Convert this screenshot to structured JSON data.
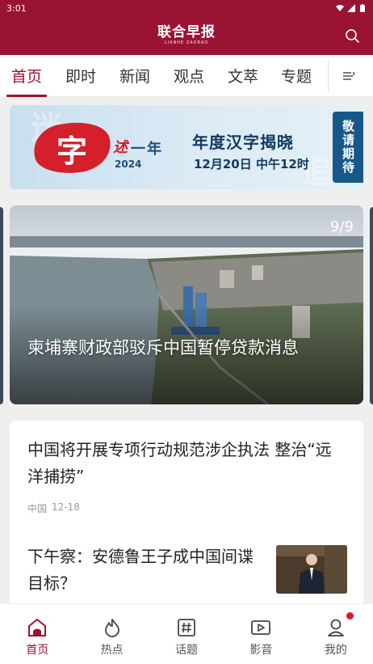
{
  "status": {
    "time": "3:01"
  },
  "header": {
    "logo_text": "联合早报",
    "logo_sub": "LIANHE ZAOBAO"
  },
  "tabs": [
    {
      "label": "首页"
    },
    {
      "label": "即时"
    },
    {
      "label": "新闻"
    },
    {
      "label": "观点"
    },
    {
      "label": "文萃"
    },
    {
      "label": "专题"
    }
  ],
  "banner": {
    "char": "字",
    "shu": "述",
    "yinian": "一年",
    "year": "2024",
    "title": "年度汉字揭晓",
    "date": "12月20日 中午12时",
    "cta": "敬请期待"
  },
  "hero": {
    "counter": "9/9",
    "caption": "柬埔寨财政部驳斥中国暂停贷款消息"
  },
  "articles": [
    {
      "title": "中国将开展专项行动规范涉企执法 整治“远洋捕捞”",
      "section": "中国",
      "date": "12-18"
    },
    {
      "title": "下午察：安德鲁王子成中国间谍目标？"
    }
  ],
  "bottom_nav": [
    {
      "label": "首页",
      "icon": "home-icon"
    },
    {
      "label": "热点",
      "icon": "flame-icon"
    },
    {
      "label": "话题",
      "icon": "hashtag-icon"
    },
    {
      "label": "影音",
      "icon": "video-icon"
    },
    {
      "label": "我的",
      "icon": "profile-icon"
    }
  ],
  "colors": {
    "brand": "#9b1333",
    "badge": "#d51f2a"
  }
}
